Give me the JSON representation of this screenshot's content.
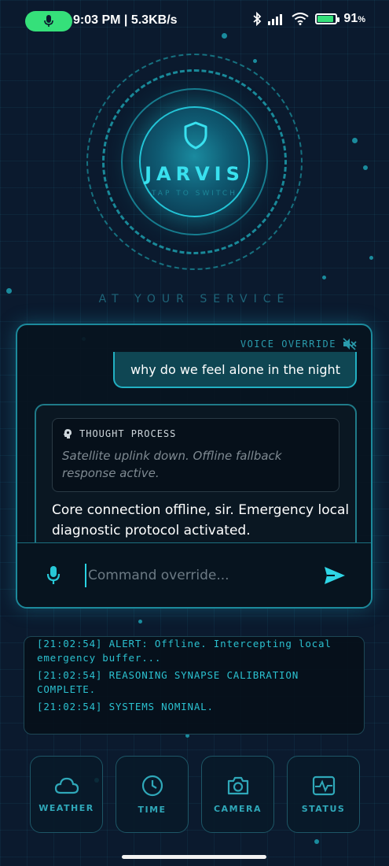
{
  "status_bar": {
    "time_speed": "9:03 PM | 5.3KB/s",
    "battery_percent": "91",
    "battery_suffix": "%",
    "battery_level": 0.91
  },
  "hero": {
    "title": "JARVIS",
    "subtitle": "TAP TO SWITCH",
    "tagline": "AT YOUR SERVICE"
  },
  "chat": {
    "voice_override_label": "VOICE OVERRIDE",
    "user_message": "why do we feel alone in the night",
    "thought_title": "THOUGHT PROCESS",
    "thought_text": "Satellite uplink down. Offline fallback response active.",
    "ai_response": "Core connection offline, sir. Emergency local diagnostic protocol activated.",
    "input_placeholder": "Command override...",
    "input_value": ""
  },
  "log": {
    "lines": [
      "[21:02:54] ALERT: Offline. Intercepting local emergency buffer...",
      "[21:02:54] REASONING SYNAPSE CALIBRATION COMPLETE.",
      "[21:02:54] SYSTEMS NOMINAL."
    ]
  },
  "actions": [
    {
      "label": "WEATHER",
      "icon": "cloud-icon"
    },
    {
      "label": "TIME",
      "icon": "clock-icon"
    },
    {
      "label": "CAMERA",
      "icon": "camera-icon"
    },
    {
      "label": "STATUS",
      "icon": "pulse-icon"
    }
  ],
  "colors": {
    "background": "#0b1a2e",
    "accent": "#39e1ef",
    "mic_pill": "#35e07a",
    "panel_border": "#1c8a9c"
  }
}
